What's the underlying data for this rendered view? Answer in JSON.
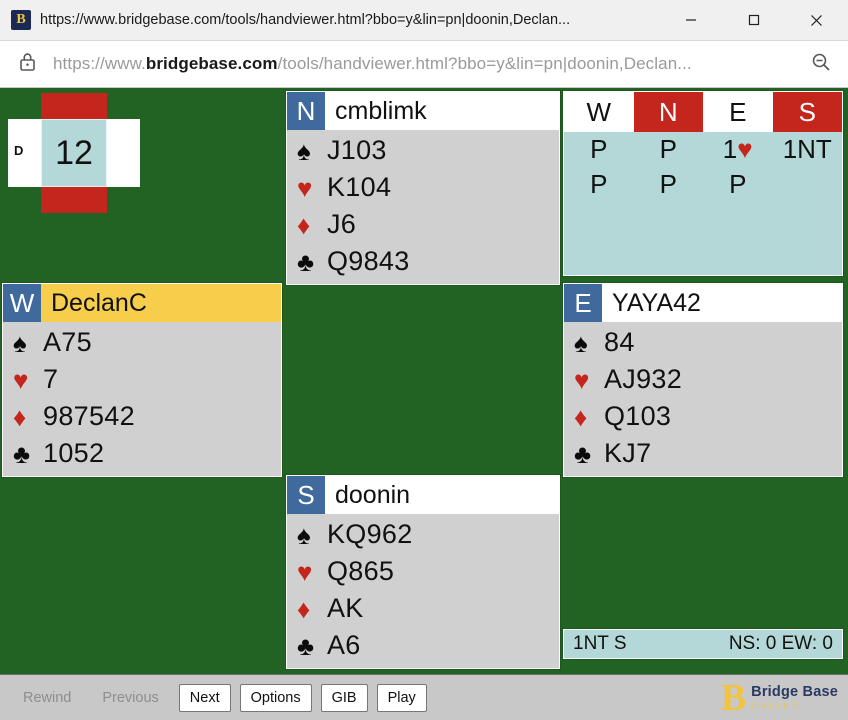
{
  "browser": {
    "favicon": "bbo-b-icon",
    "title": "https://www.bridgebase.com/tools/handviewer.html?bbo=y&lin=pn|doonin,Declan...",
    "minimize_label": "─",
    "maximize_label": "☐",
    "close_label": "✕",
    "lock_icon": "padlock-icon",
    "zoom_icon": "zoom-out-icon",
    "url_prefix": "https://www.",
    "url_domain": "bridgebase.com",
    "url_suffix": "/tools/handviewer.html?bbo=y&lin=pn|doonin,Declan..."
  },
  "board": {
    "number": "12",
    "dealer_mark": "D",
    "dealer_seat": "W",
    "vulnerable": "NS",
    "colors": {
      "vulnerable": "#c4261d",
      "not_vulnerable": "#ffffff",
      "center": "#b4d7d7",
      "felt": "#226324"
    }
  },
  "hands": {
    "north": {
      "seat": "N",
      "player": "cmblimk",
      "active": false,
      "suits": [
        {
          "symbol": "♠",
          "color": "black",
          "cards": "J103"
        },
        {
          "symbol": "♥",
          "color": "red",
          "cards": "K104"
        },
        {
          "symbol": "♦",
          "color": "red",
          "cards": "J6"
        },
        {
          "symbol": "♣",
          "color": "black",
          "cards": "Q9843"
        }
      ]
    },
    "west": {
      "seat": "W",
      "player": "DeclanC",
      "active": true,
      "suits": [
        {
          "symbol": "♠",
          "color": "black",
          "cards": "A75"
        },
        {
          "symbol": "♥",
          "color": "red",
          "cards": "7"
        },
        {
          "symbol": "♦",
          "color": "red",
          "cards": "987542"
        },
        {
          "symbol": "♣",
          "color": "black",
          "cards": "1052"
        }
      ]
    },
    "east": {
      "seat": "E",
      "player": "YAYA42",
      "active": false,
      "suits": [
        {
          "symbol": "♠",
          "color": "black",
          "cards": "84"
        },
        {
          "symbol": "♥",
          "color": "red",
          "cards": "AJ932"
        },
        {
          "symbol": "♦",
          "color": "red",
          "cards": "Q103"
        },
        {
          "symbol": "♣",
          "color": "black",
          "cards": "KJ7"
        }
      ]
    },
    "south": {
      "seat": "S",
      "player": "doonin",
      "active": false,
      "suits": [
        {
          "symbol": "♠",
          "color": "black",
          "cards": "KQ962"
        },
        {
          "symbol": "♥",
          "color": "red",
          "cards": "Q865"
        },
        {
          "symbol": "♦",
          "color": "red",
          "cards": "AK"
        },
        {
          "symbol": "♣",
          "color": "black",
          "cards": "A6"
        }
      ]
    }
  },
  "auction": {
    "headers": [
      {
        "label": "W",
        "vulnerable": false
      },
      {
        "label": "N",
        "vulnerable": true
      },
      {
        "label": "E",
        "vulnerable": false
      },
      {
        "label": "S",
        "vulnerable": true
      }
    ],
    "rows": [
      [
        {
          "level": "P",
          "suit": ""
        },
        {
          "level": "P",
          "suit": ""
        },
        {
          "level": "1",
          "suit": "♥"
        },
        {
          "level": "1NT",
          "suit": ""
        }
      ],
      [
        {
          "level": "P",
          "suit": ""
        },
        {
          "level": "P",
          "suit": ""
        },
        {
          "level": "P",
          "suit": ""
        },
        {
          "level": "",
          "suit": ""
        }
      ]
    ]
  },
  "contract": {
    "text": "1NT S",
    "score": "NS: 0 EW: 0"
  },
  "toolbar": {
    "buttons": [
      {
        "label": "Rewind",
        "enabled": false
      },
      {
        "label": "Previous",
        "enabled": false
      },
      {
        "label": "Next",
        "enabled": true
      },
      {
        "label": "Options",
        "enabled": true
      },
      {
        "label": "GIB",
        "enabled": true
      },
      {
        "label": "Play",
        "enabled": true
      }
    ]
  },
  "logo": {
    "mark": "B",
    "name": "Bridge Base",
    "tagline": "ONLINE"
  }
}
